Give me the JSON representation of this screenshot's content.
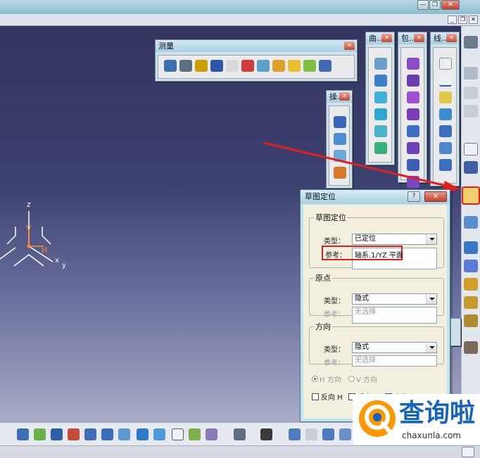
{
  "window": {
    "minimize_glyph": "—",
    "restore_glyph": "❐",
    "close_glyph": "✕"
  },
  "mdi": {
    "minimize_glyph": "_",
    "restore_glyph": "❐",
    "close_glyph": "✕"
  },
  "axes": {
    "z": "z",
    "v": "V",
    "h": "H",
    "x": "x",
    "y": "y"
  },
  "toolbars": {
    "measure": {
      "title": "测量"
    },
    "surface": {
      "title": "曲..."
    },
    "wrap": {
      "title": "包..."
    },
    "line": {
      "title": "线..."
    },
    "operation": {
      "title": "操..."
    },
    "close_glyph": "✕"
  },
  "dialog": {
    "title": "草图定位",
    "help_glyph": "?",
    "close_glyph": "✕",
    "sketch_positioning": {
      "legend": "草图定位",
      "type_label": "类型：",
      "type_value": "已定位",
      "ref_label": "参考：",
      "ref_value": "轴系.1/YZ 平面"
    },
    "origin": {
      "legend": "原点",
      "type_label": "类型：",
      "type_value": "隐式",
      "ref_label": "参考：",
      "ref_value": "无选择"
    },
    "direction": {
      "legend": "方向",
      "type_label": "类型：",
      "type_value": "隐式",
      "ref_label": "参考：",
      "ref_value": "无选择"
    },
    "h_direction": "H 方向",
    "v_direction": "V 方向",
    "reverse_h": "反向 H",
    "reverse_v": "反向 V",
    "swap": "交换"
  },
  "watermark": {
    "brand": "查询啦",
    "domain": "chaxunla.com",
    "brand_color": "#1565c0",
    "accent": "#ff9800"
  },
  "colors": {
    "highlight": "#e0201c",
    "canvas_top": "#33345f",
    "canvas_bottom": "#a9acc7"
  }
}
